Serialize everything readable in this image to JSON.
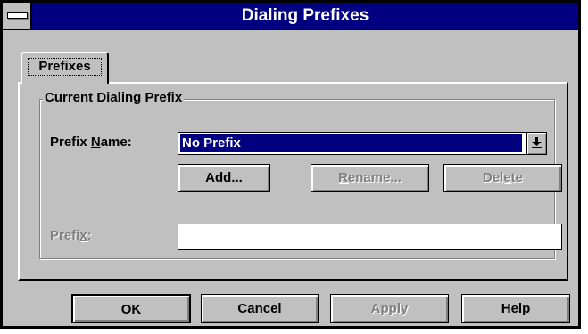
{
  "window": {
    "title": "Dialing Prefixes"
  },
  "tabs": [
    {
      "label": "Prefixes",
      "selected": true
    }
  ],
  "group": {
    "label": "Current Dialing Prefix"
  },
  "prefix_name": {
    "label_before": "Prefix ",
    "label_mnemonic": "N",
    "label_after": "ame:",
    "value": "No Prefix"
  },
  "actions": {
    "add": {
      "before": "A",
      "mnemonic": "d",
      "after": "d...",
      "enabled": true
    },
    "rename": {
      "before": "",
      "mnemonic": "R",
      "after": "ename...",
      "enabled": false
    },
    "delete": {
      "before": "Del",
      "mnemonic": "e",
      "after": "te",
      "enabled": false
    }
  },
  "prefix": {
    "label_before": "Prefi",
    "label_mnemonic": "x",
    "label_after": ":",
    "value": "",
    "enabled": false
  },
  "footer": {
    "ok": "OK",
    "cancel": "Cancel",
    "apply": "Apply",
    "help": "Help"
  },
  "colors": {
    "titlebar": "#000080",
    "face": "#c0c0c0",
    "selection": "#000080",
    "disabled_text": "#808080"
  },
  "icons": {
    "system_menu": "system-menu-icon",
    "dropdown": "dropdown-arrow-icon"
  }
}
